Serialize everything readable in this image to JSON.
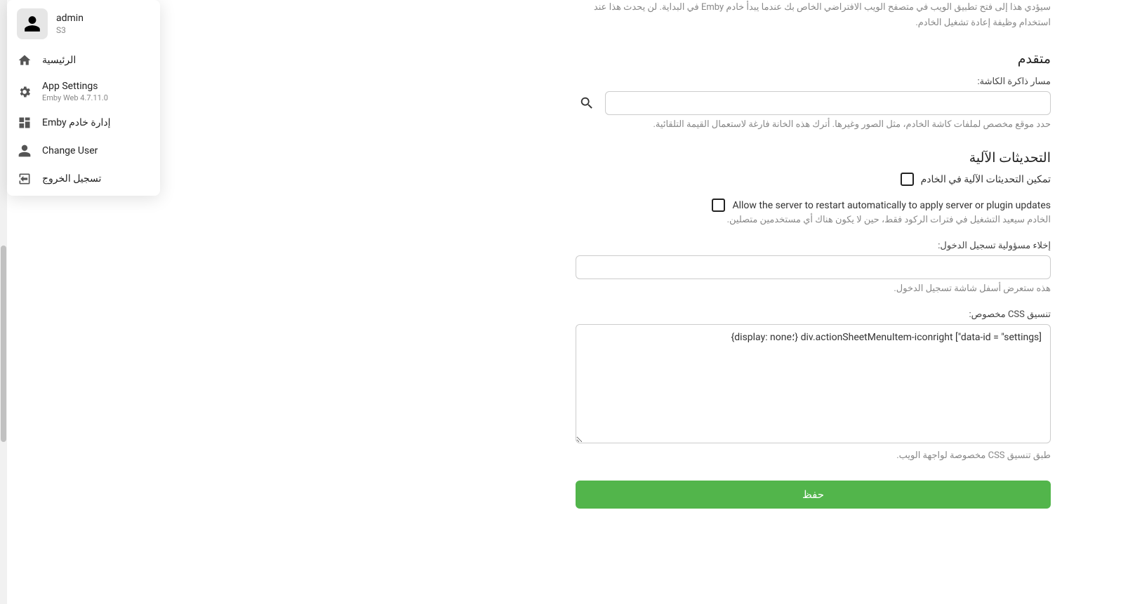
{
  "user_menu": {
    "name": "admin",
    "sub": "S3",
    "items": [
      {
        "label": "الرئيسية",
        "sub": ""
      },
      {
        "label": "App Settings",
        "sub": "Emby Web 4.7.11.0"
      },
      {
        "label": "إدارة خادم Emby",
        "sub": ""
      },
      {
        "label": "Change User",
        "sub": ""
      },
      {
        "label": "تسجيل الخروج",
        "sub": ""
      }
    ]
  },
  "top_help": "سيؤدي هذا إلى فتح تطبيق الويب في متصفح الويب الافتراضي الخاص بك عندما يبدأ خادم Emby في البداية. لن يحدث هذا عند استخدام وظيفة إعادة تشغيل الخادم.",
  "advanced": {
    "title": "متقدم",
    "cache_path": {
      "label": "مسار ذاكرة الكاشة:",
      "value": "",
      "help": "حدد موقع مخصص لملفات كاشة الخادم، مثل الصور وغيرها. أترك هذه الخانة فارغة لاستعمال القيمة التلقائية."
    }
  },
  "updates": {
    "title": "التحديثات الآلية",
    "enable": {
      "label": "تمكين التحديثات الآلية في الخادم"
    },
    "restart": {
      "label": "Allow the server to restart automatically to apply server or plugin updates",
      "help": "الخادم سيعيد التشغيل في فترات الركود فقط، حين لا يكون هناك أي مستخدمين متصلين."
    }
  },
  "login_disclaimer": {
    "label": "إخلاء مسؤولية تسجيل الدخول:",
    "value": "",
    "help": "هذه ستعرض أسفل شاشة تسجيل الدخول."
  },
  "custom_css": {
    "label": "تنسيق CSS مخصوص:",
    "value": "div.actionSheetMenuItem-iconright [\"data-id = \"settings] {؛display: none}",
    "help": "طبق تنسيق CSS مخصوصة لواجهة الويب."
  },
  "save": "حفظ"
}
